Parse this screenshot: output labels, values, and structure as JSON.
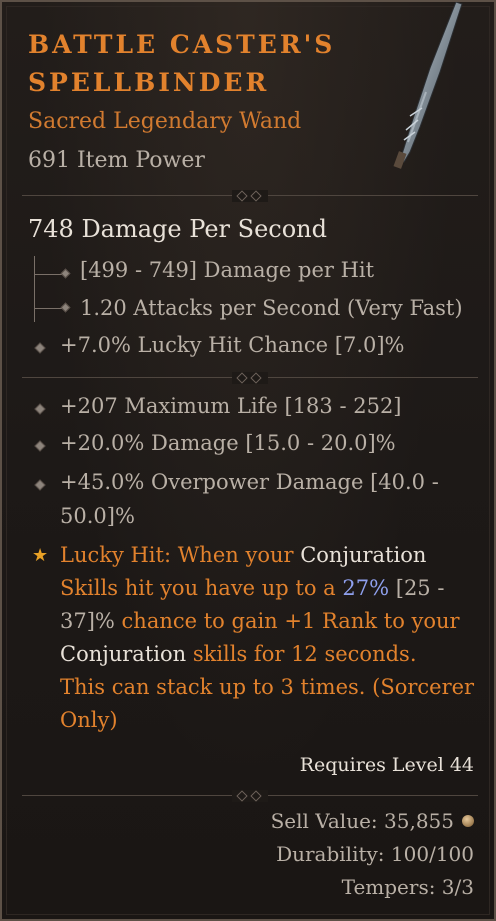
{
  "item": {
    "name_line1": "BATTLE CASTER'S",
    "name_line2": "SPELLBINDER",
    "type": "Sacred Legendary Wand",
    "item_power": "691 Item Power"
  },
  "weapon": {
    "dps": "748 Damage Per Second",
    "damage_per_hit": "[499 - 749] Damage per Hit",
    "attack_speed": "1.20 Attacks per Second (Very Fast)"
  },
  "implicit": "+7.0% Lucky Hit Chance [7.0]%",
  "affixes": [
    "+207 Maximum Life [183 - 252]",
    "+20.0% Damage [15.0 - 20.0]%",
    "+45.0% Overpower Damage [40.0 -",
    "50.0]%"
  ],
  "aspect": {
    "p1": "Lucky Hit: When your ",
    "p2": "Conjuration",
    "p3": "Skills hit you have up to a ",
    "p4": "27%",
    "p5": " [25 -",
    "p6": "37]%",
    "p7": " chance to gain +1 Rank to your",
    "p8": "Conjuration",
    "p9": " skills for 12 seconds.",
    "p10": "This can stack up to 3 times. (Sorcerer",
    "p11": "Only)"
  },
  "requirements": "Requires Level 44",
  "footer": {
    "sell_value": "Sell Value: 35,855",
    "durability": "Durability: 100/100",
    "tempers": "Tempers: 3/3"
  },
  "colors": {
    "legendary_orange": "#e2822d",
    "stat_gray": "#b9b0a6",
    "highlight_blue": "#8fa0ee",
    "star_gold": "#e8a126"
  },
  "icons": [
    "wand-icon",
    "tree-branch-icon",
    "diamond-bullet-icon",
    "star-icon",
    "coin-icon"
  ]
}
